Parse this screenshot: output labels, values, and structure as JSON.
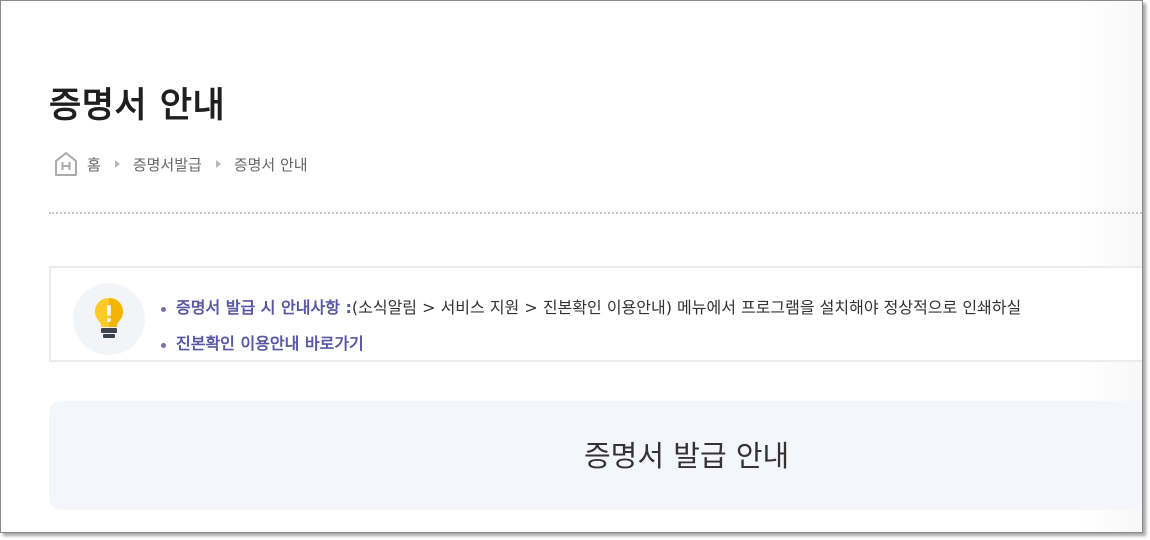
{
  "page": {
    "title": "증명서 안내"
  },
  "breadcrumb": {
    "items": [
      "홈",
      "증명서발급",
      "증명서 안내"
    ]
  },
  "notice": {
    "items": [
      {
        "label": "증명서 발급 시 안내사항 :",
        "text": " (소식알림 > 서비스 지원 > 진본확인 이용안내) 메뉴에서 프로그램을 설치해야 정상적으로 인쇄하실"
      },
      {
        "label": "진본확인 이용안내 바로가기"
      }
    ]
  },
  "panel": {
    "title": "증명서 발급 안내"
  },
  "colors": {
    "accent": "#5b57a3",
    "panel_bg": "#f4f6fb",
    "bulb_yellow": "#ffc928"
  }
}
